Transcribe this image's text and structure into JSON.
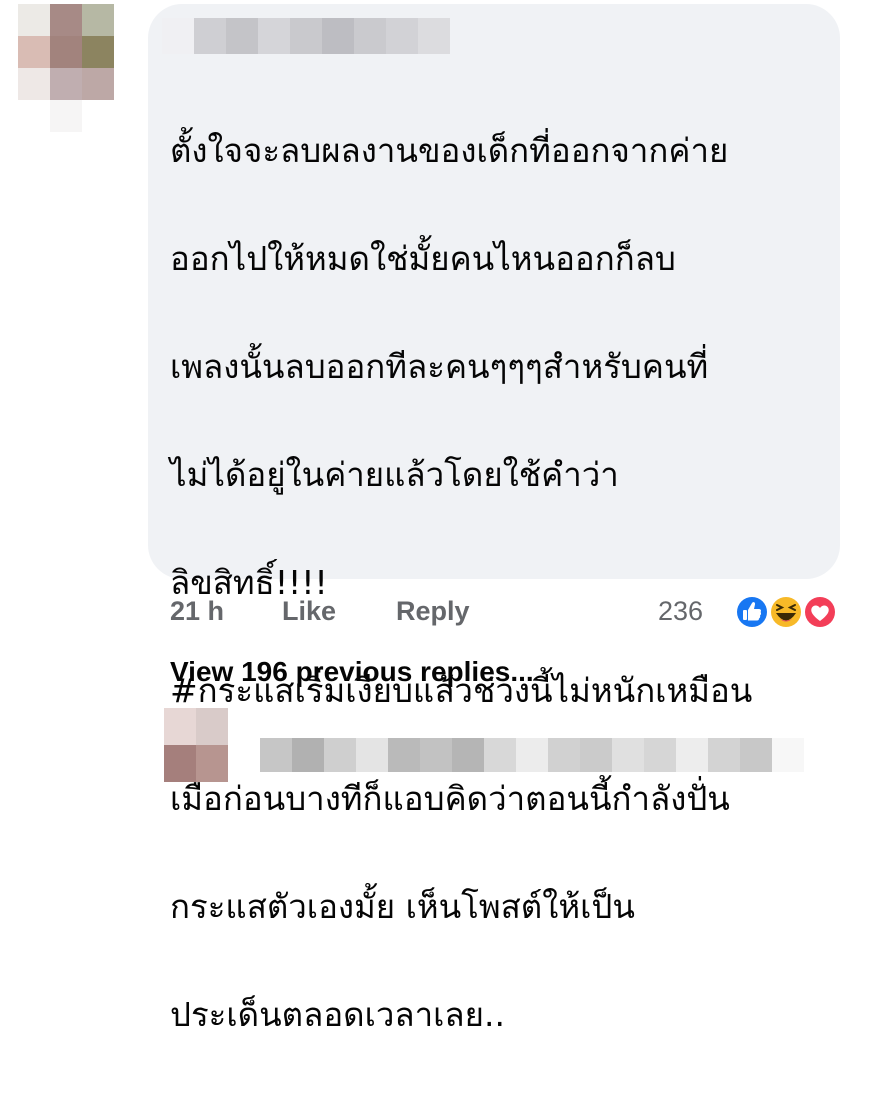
{
  "comment": {
    "lines": [
      "ตั้งใจจะลบผลงานของเด็กที่ออกจากค่าย",
      "ออกไปให้หมดใช่มั้ยคนไหนออกก็ลบ",
      "เพลงนั้นลบออกทีละคนๆๆๆสำหรับคนที่",
      "ไม่ได้อยู่ในค่ายแล้วโดยใช้คำว่า",
      "ลิขสิทธิ์!!!!",
      "#กระแสเริ่มเงียบแล้วช่วงนี้ไม่หนักเหมือน",
      "เมื่อก่อนบางทีก็แอบคิดว่าตอนนี้กำลังปั่น",
      "กระแสตัวเองมั้ย เห็นโพสต์ให้เป็น",
      "ประเด็นตลอดเวลาเลย.."
    ]
  },
  "actions": {
    "time": "21 h",
    "like_label": "Like",
    "reply_label": "Reply",
    "reaction_count": "236",
    "reactions": [
      "like-icon",
      "haha-icon",
      "love-icon"
    ]
  },
  "view_replies": "View 196 previous replies...",
  "colors": {
    "bubble": "#f0f2f5",
    "secondary_text": "#65676b",
    "primary_text": "#050505",
    "like_blue": "#1877f2",
    "love_red": "#f33e58",
    "haha_yellow": "#f7b928"
  }
}
